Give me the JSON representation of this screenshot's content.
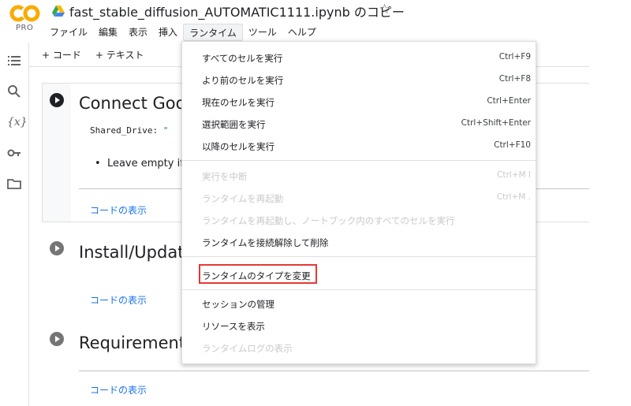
{
  "app": {
    "logo_text": "CO",
    "plan_badge": "PRO",
    "notebook_title": "fast_stable_diffusion_AUTOMATIC1111.ipynb のコピー",
    "star_icon": "star-outline-icon"
  },
  "menubar": {
    "items": [
      "ファイル",
      "編集",
      "表示",
      "挿入",
      "ランタイム",
      "ツール",
      "ヘルプ"
    ]
  },
  "toolbar": {
    "add_code": "+ コード",
    "add_text": "+ テキスト"
  },
  "rail": {
    "icons": [
      "toc-icon",
      "search-icon",
      "variables-icon",
      "key-icon",
      "folder-icon"
    ],
    "variables_glyph": "{x}"
  },
  "cells": [
    {
      "heading": "Connect Goo",
      "code_label": "Shared_Drive:",
      "code_value": "\"",
      "bullet": "Leave empty if",
      "show_code": "コードの表示"
    },
    {
      "heading": "Install/Updat",
      "show_code": "コードの表示"
    },
    {
      "heading": "Requirement",
      "show_code": "コードの表示"
    }
  ],
  "runtime_menu": {
    "items": [
      {
        "label": "すべてのセルを実行",
        "shortcut": "Ctrl+F9",
        "enabled": true
      },
      {
        "label": "より前のセルを実行",
        "shortcut": "Ctrl+F8",
        "enabled": true
      },
      {
        "label": "現在のセルを実行",
        "shortcut": "Ctrl+Enter",
        "enabled": true
      },
      {
        "label": "選択範囲を実行",
        "shortcut": "Ctrl+Shift+Enter",
        "enabled": true
      },
      {
        "label": "以降のセルを実行",
        "shortcut": "Ctrl+F10",
        "enabled": true
      },
      {
        "label": "実行を中断",
        "shortcut": "Ctrl+M I",
        "enabled": false
      },
      {
        "label": "ランタイムを再起動",
        "shortcut": "Ctrl+M .",
        "enabled": false
      },
      {
        "label": "ランタイムを再起動し、ノートブック内のすべてのセルを実行",
        "shortcut": "",
        "enabled": false
      },
      {
        "label": "ランタイムを接続解除して削除",
        "shortcut": "",
        "enabled": true
      },
      {
        "label": "ランタイムのタイプを変更",
        "shortcut": "",
        "enabled": true
      },
      {
        "label": "セッションの管理",
        "shortcut": "",
        "enabled": true
      },
      {
        "label": "リソースを表示",
        "shortcut": "",
        "enabled": true
      },
      {
        "label": "ランタイムログの表示",
        "shortcut": "",
        "enabled": false
      }
    ],
    "highlight_color": "#e53935"
  }
}
